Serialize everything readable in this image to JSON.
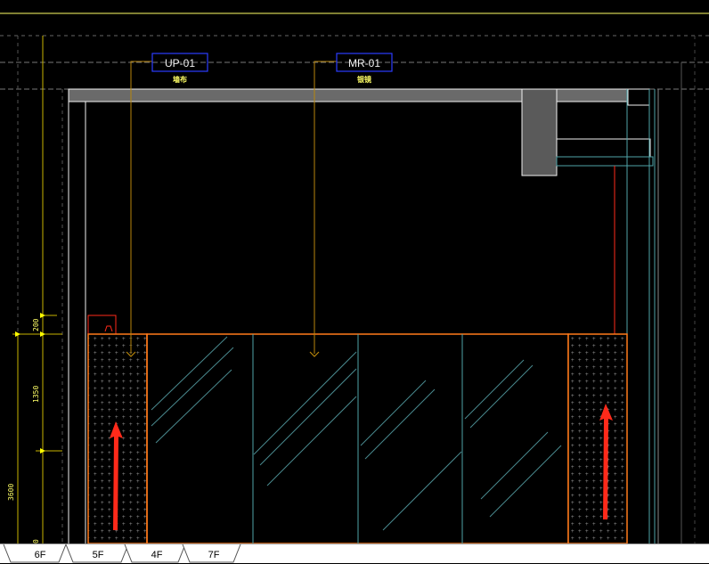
{
  "drawing": {
    "background_color": "#000000",
    "colors": {
      "tag_border": "#2b3cff",
      "tag_text": "#ffff66",
      "leader": "#b8860b",
      "dimension": "#ffff00",
      "orange": "#ff7a1a",
      "red": "#ff2a1a",
      "cyan": "#4fa3a8",
      "white": "#f0f0f0",
      "gray_fill": "#5a5a5a"
    },
    "tags": [
      {
        "code": "UP-01",
        "name": "墙布"
      },
      {
        "code": "MR-01",
        "name": "银镜"
      }
    ],
    "dimensions": {
      "d200": "200",
      "d1350": "1350",
      "d3600": "3600",
      "d0": "0"
    }
  },
  "tabs": [
    {
      "label": "6F",
      "active": true
    },
    {
      "label": "5F",
      "active": false
    },
    {
      "label": "4F",
      "active": false
    },
    {
      "label": "7F",
      "active": false
    }
  ]
}
